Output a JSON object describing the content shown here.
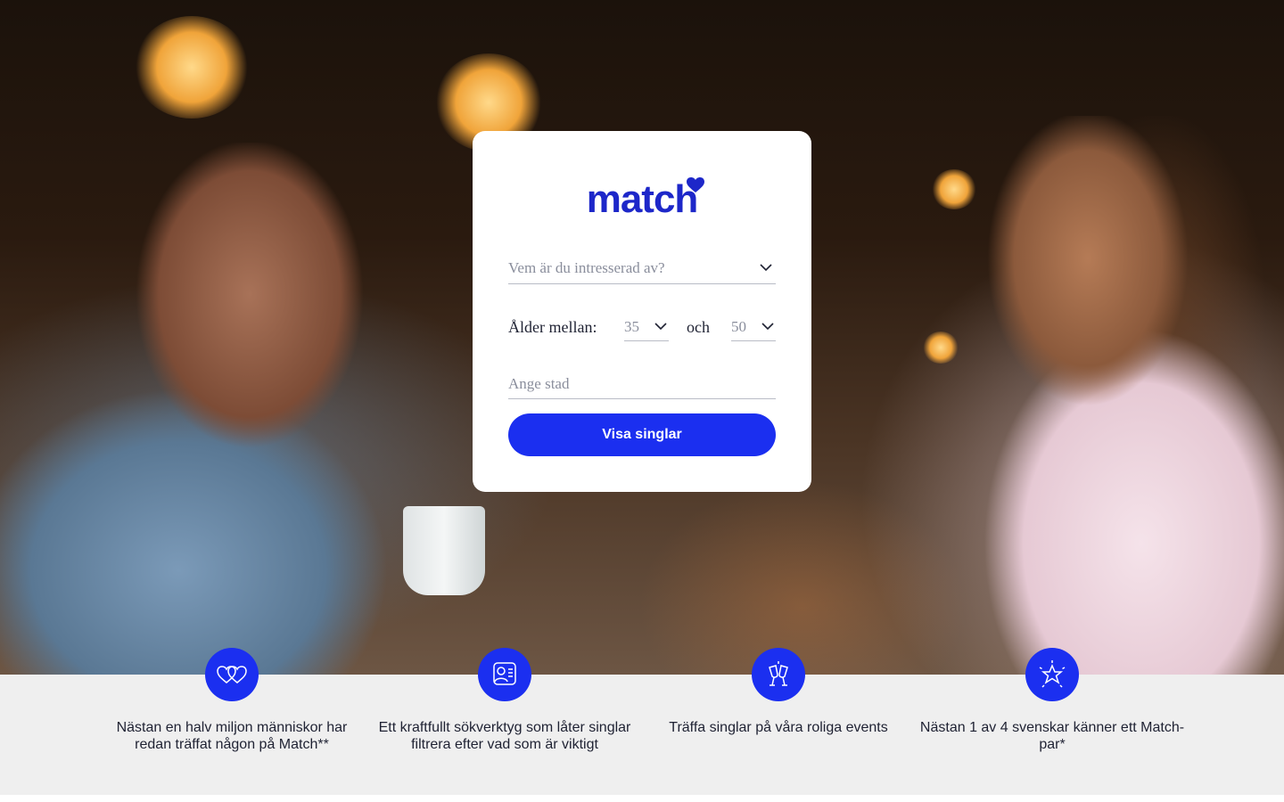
{
  "brand": {
    "logo_text": "match",
    "accent_color": "#1b2ff0",
    "logo_color": "#1d27c9"
  },
  "search_form": {
    "interest_placeholder": "Vem är du intresserad av?",
    "age_label": "Ålder mellan:",
    "age_min": "35",
    "age_connector": "och",
    "age_max": "50",
    "city_placeholder": "Ange stad",
    "submit_label": "Visa singlar"
  },
  "features": [
    {
      "icon": "hearts-icon",
      "text": "Nästan en halv miljon människor har redan träffat någon på Match**"
    },
    {
      "icon": "profile-search-icon",
      "text": "Ett kraftfullt sökverktyg som låter singlar filtrera efter vad som är viktigt"
    },
    {
      "icon": "champagne-toast-icon",
      "text": "Träffa singlar på våra roliga events"
    },
    {
      "icon": "star-sparkle-icon",
      "text": "Nästan 1 av 4 svenskar känner ett Match-par*"
    }
  ]
}
